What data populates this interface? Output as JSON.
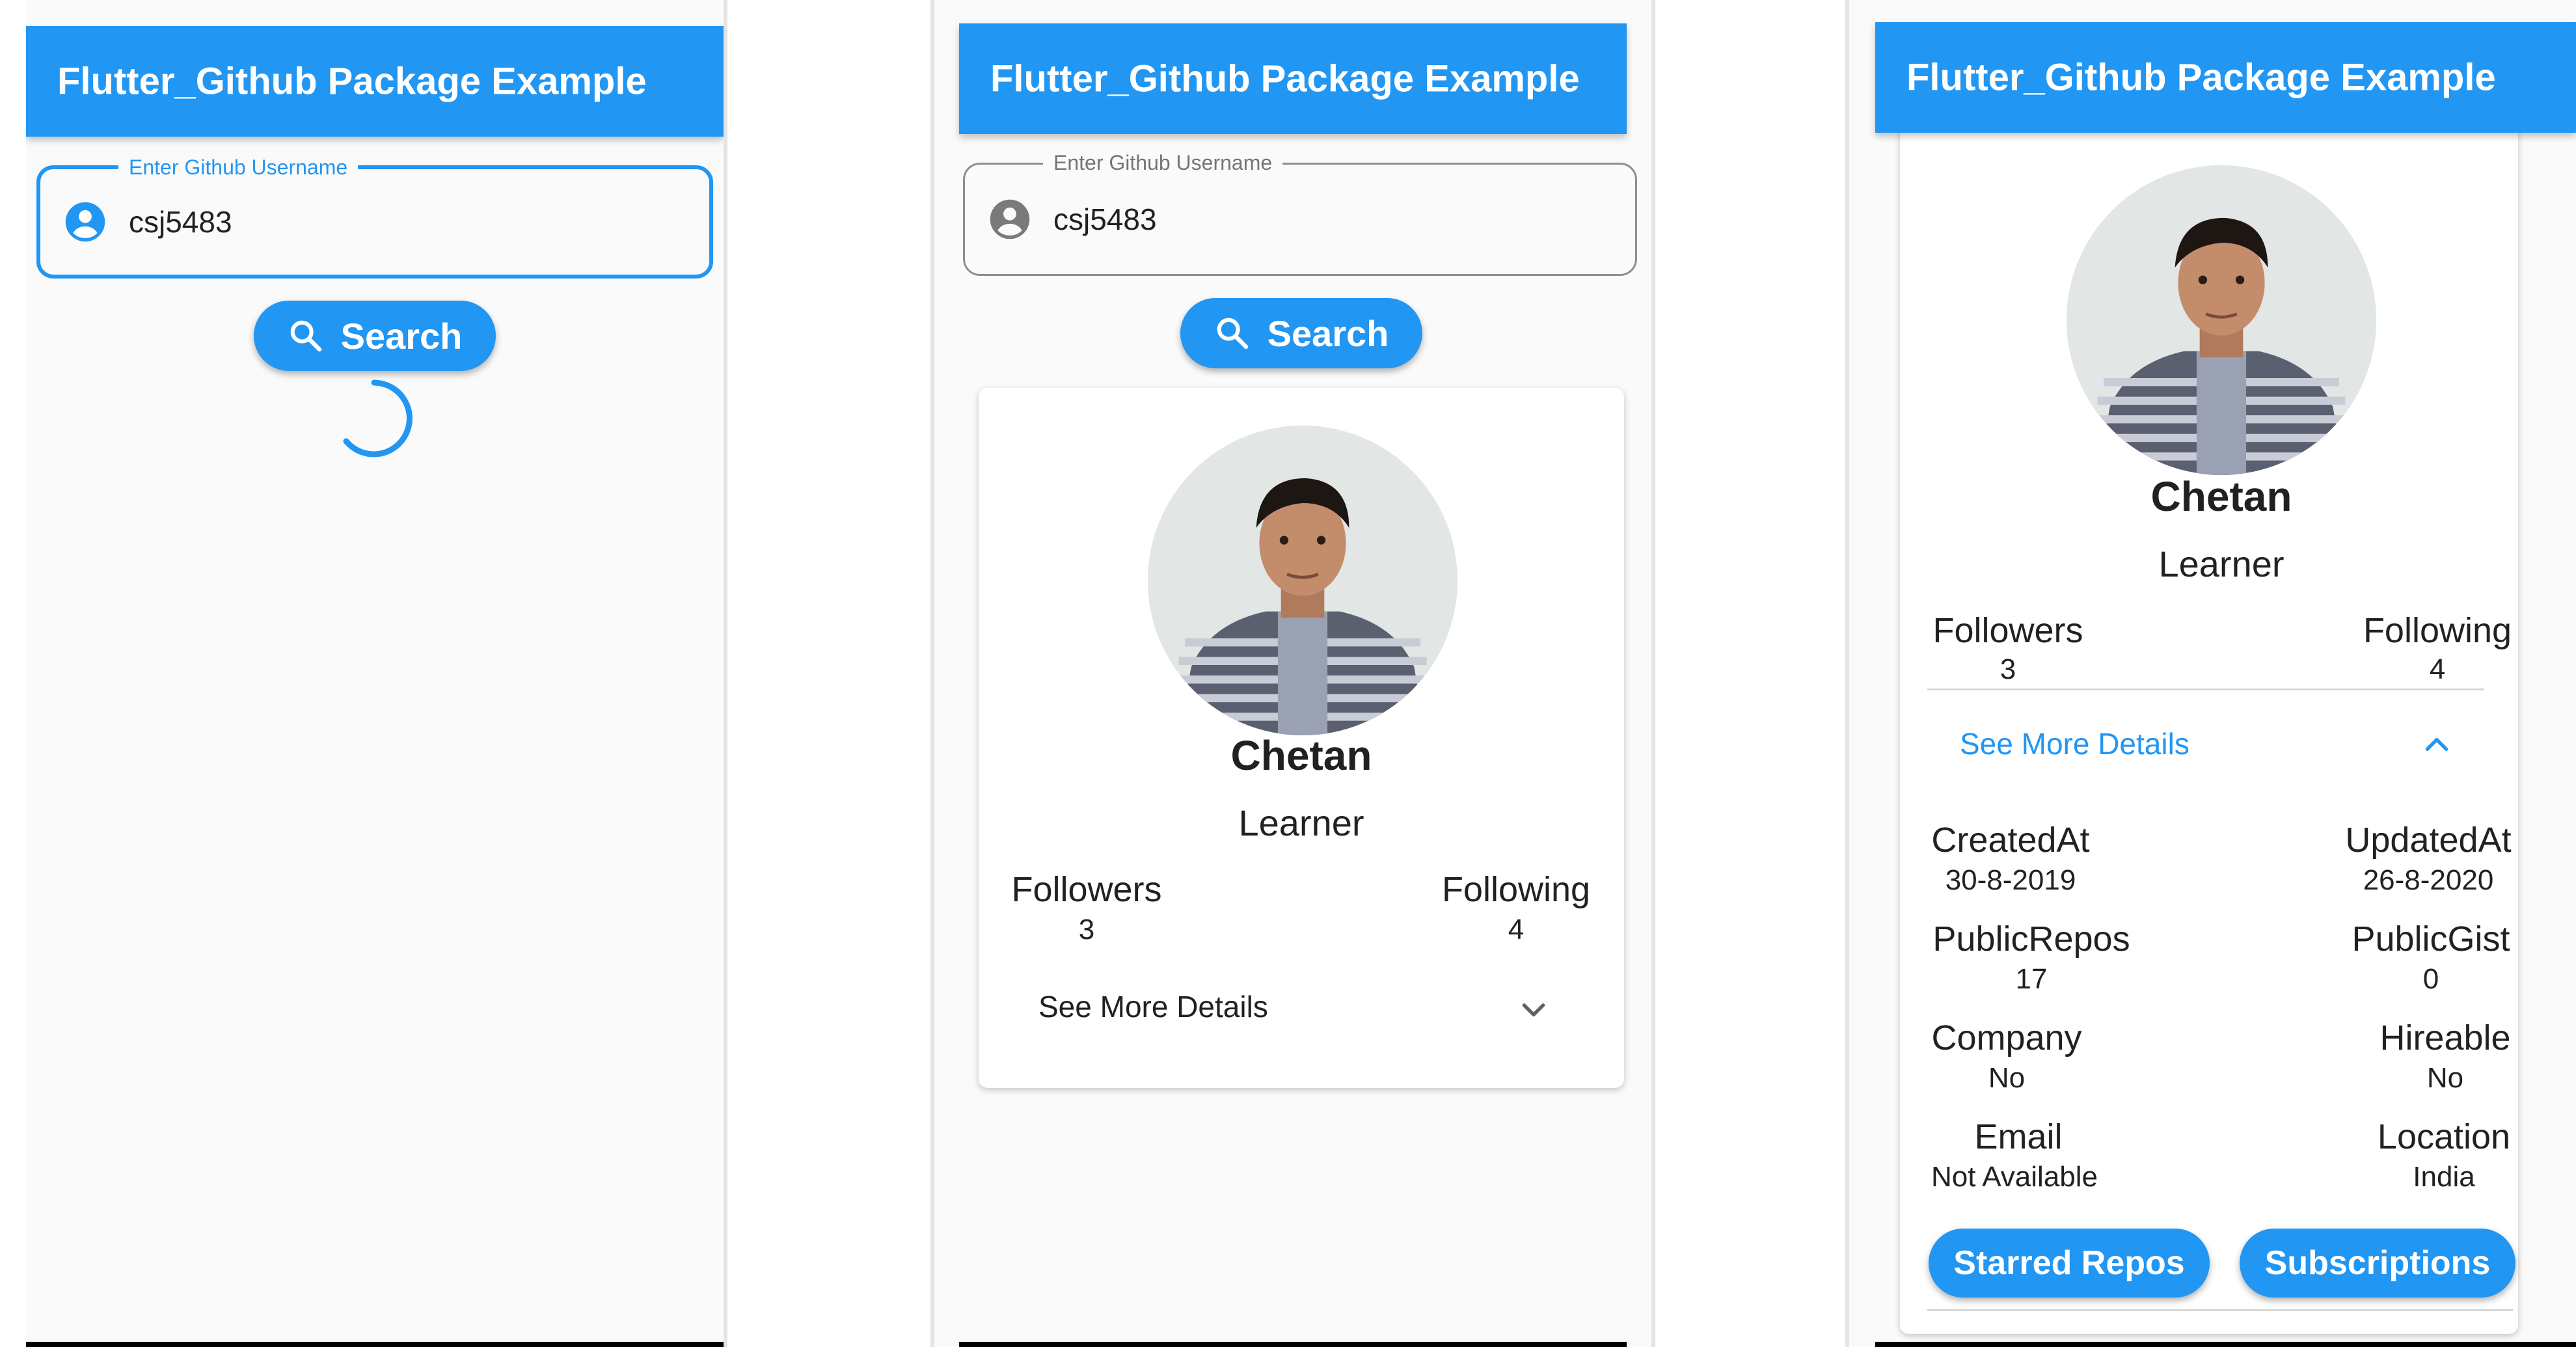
{
  "app": {
    "title": "Flutter_Github Package Example"
  },
  "search": {
    "label": "Enter Github Username",
    "value": "csj5483",
    "button_label": "Search",
    "icon": "account-circle-icon"
  },
  "loading": {
    "icon": "circular-progress-indicator"
  },
  "profile": {
    "name": "Chetan",
    "bio": "Learner",
    "followers_label": "Followers",
    "followers_value": "3",
    "following_label": "Following",
    "following_value": "4",
    "see_more_label": "See More Details"
  },
  "details": {
    "created_label": "CreatedAt",
    "created_value": "30-8-2019",
    "updated_label": "UpdatedAt",
    "updated_value": "26-8-2020",
    "repos_label": "PublicRepos",
    "repos_value": "17",
    "gist_label": "PublicGist",
    "gist_value": "0",
    "company_label": "Company",
    "company_value": "No",
    "hireable_label": "Hireable",
    "hireable_value": "No",
    "email_label": "Email",
    "email_value": "Not Available",
    "location_label": "Location",
    "location_value": "India"
  },
  "actions": {
    "starred_label": "Starred Repos",
    "subscriptions_label": "Subscriptions"
  },
  "colors": {
    "primary": "#2196f3",
    "background": "#fafafa",
    "text": "#212121"
  }
}
